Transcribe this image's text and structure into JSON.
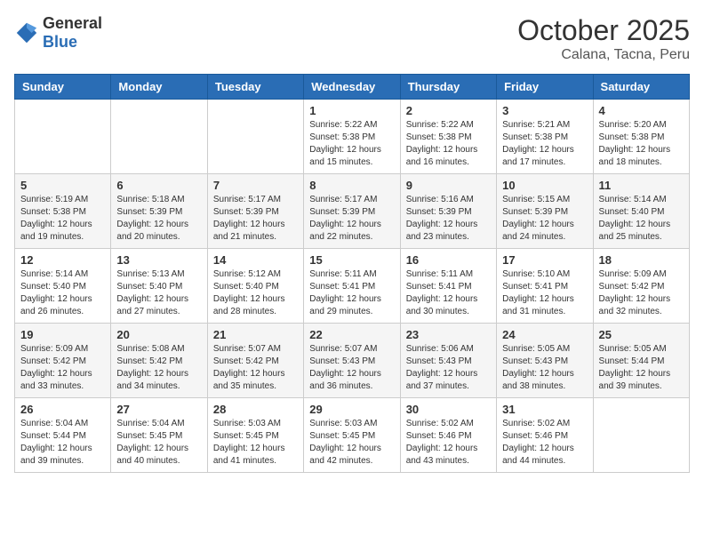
{
  "header": {
    "logo_general": "General",
    "logo_blue": "Blue",
    "month": "October 2025",
    "location": "Calana, Tacna, Peru"
  },
  "weekdays": [
    "Sunday",
    "Monday",
    "Tuesday",
    "Wednesday",
    "Thursday",
    "Friday",
    "Saturday"
  ],
  "weeks": [
    [
      {
        "day": "",
        "sunrise": "",
        "sunset": "",
        "daylight": ""
      },
      {
        "day": "",
        "sunrise": "",
        "sunset": "",
        "daylight": ""
      },
      {
        "day": "",
        "sunrise": "",
        "sunset": "",
        "daylight": ""
      },
      {
        "day": "1",
        "sunrise": "Sunrise: 5:22 AM",
        "sunset": "Sunset: 5:38 PM",
        "daylight": "Daylight: 12 hours and 15 minutes."
      },
      {
        "day": "2",
        "sunrise": "Sunrise: 5:22 AM",
        "sunset": "Sunset: 5:38 PM",
        "daylight": "Daylight: 12 hours and 16 minutes."
      },
      {
        "day": "3",
        "sunrise": "Sunrise: 5:21 AM",
        "sunset": "Sunset: 5:38 PM",
        "daylight": "Daylight: 12 hours and 17 minutes."
      },
      {
        "day": "4",
        "sunrise": "Sunrise: 5:20 AM",
        "sunset": "Sunset: 5:38 PM",
        "daylight": "Daylight: 12 hours and 18 minutes."
      }
    ],
    [
      {
        "day": "5",
        "sunrise": "Sunrise: 5:19 AM",
        "sunset": "Sunset: 5:38 PM",
        "daylight": "Daylight: 12 hours and 19 minutes."
      },
      {
        "day": "6",
        "sunrise": "Sunrise: 5:18 AM",
        "sunset": "Sunset: 5:39 PM",
        "daylight": "Daylight: 12 hours and 20 minutes."
      },
      {
        "day": "7",
        "sunrise": "Sunrise: 5:17 AM",
        "sunset": "Sunset: 5:39 PM",
        "daylight": "Daylight: 12 hours and 21 minutes."
      },
      {
        "day": "8",
        "sunrise": "Sunrise: 5:17 AM",
        "sunset": "Sunset: 5:39 PM",
        "daylight": "Daylight: 12 hours and 22 minutes."
      },
      {
        "day": "9",
        "sunrise": "Sunrise: 5:16 AM",
        "sunset": "Sunset: 5:39 PM",
        "daylight": "Daylight: 12 hours and 23 minutes."
      },
      {
        "day": "10",
        "sunrise": "Sunrise: 5:15 AM",
        "sunset": "Sunset: 5:39 PM",
        "daylight": "Daylight: 12 hours and 24 minutes."
      },
      {
        "day": "11",
        "sunrise": "Sunrise: 5:14 AM",
        "sunset": "Sunset: 5:40 PM",
        "daylight": "Daylight: 12 hours and 25 minutes."
      }
    ],
    [
      {
        "day": "12",
        "sunrise": "Sunrise: 5:14 AM",
        "sunset": "Sunset: 5:40 PM",
        "daylight": "Daylight: 12 hours and 26 minutes."
      },
      {
        "day": "13",
        "sunrise": "Sunrise: 5:13 AM",
        "sunset": "Sunset: 5:40 PM",
        "daylight": "Daylight: 12 hours and 27 minutes."
      },
      {
        "day": "14",
        "sunrise": "Sunrise: 5:12 AM",
        "sunset": "Sunset: 5:40 PM",
        "daylight": "Daylight: 12 hours and 28 minutes."
      },
      {
        "day": "15",
        "sunrise": "Sunrise: 5:11 AM",
        "sunset": "Sunset: 5:41 PM",
        "daylight": "Daylight: 12 hours and 29 minutes."
      },
      {
        "day": "16",
        "sunrise": "Sunrise: 5:11 AM",
        "sunset": "Sunset: 5:41 PM",
        "daylight": "Daylight: 12 hours and 30 minutes."
      },
      {
        "day": "17",
        "sunrise": "Sunrise: 5:10 AM",
        "sunset": "Sunset: 5:41 PM",
        "daylight": "Daylight: 12 hours and 31 minutes."
      },
      {
        "day": "18",
        "sunrise": "Sunrise: 5:09 AM",
        "sunset": "Sunset: 5:42 PM",
        "daylight": "Daylight: 12 hours and 32 minutes."
      }
    ],
    [
      {
        "day": "19",
        "sunrise": "Sunrise: 5:09 AM",
        "sunset": "Sunset: 5:42 PM",
        "daylight": "Daylight: 12 hours and 33 minutes."
      },
      {
        "day": "20",
        "sunrise": "Sunrise: 5:08 AM",
        "sunset": "Sunset: 5:42 PM",
        "daylight": "Daylight: 12 hours and 34 minutes."
      },
      {
        "day": "21",
        "sunrise": "Sunrise: 5:07 AM",
        "sunset": "Sunset: 5:42 PM",
        "daylight": "Daylight: 12 hours and 35 minutes."
      },
      {
        "day": "22",
        "sunrise": "Sunrise: 5:07 AM",
        "sunset": "Sunset: 5:43 PM",
        "daylight": "Daylight: 12 hours and 36 minutes."
      },
      {
        "day": "23",
        "sunrise": "Sunrise: 5:06 AM",
        "sunset": "Sunset: 5:43 PM",
        "daylight": "Daylight: 12 hours and 37 minutes."
      },
      {
        "day": "24",
        "sunrise": "Sunrise: 5:05 AM",
        "sunset": "Sunset: 5:43 PM",
        "daylight": "Daylight: 12 hours and 38 minutes."
      },
      {
        "day": "25",
        "sunrise": "Sunrise: 5:05 AM",
        "sunset": "Sunset: 5:44 PM",
        "daylight": "Daylight: 12 hours and 39 minutes."
      }
    ],
    [
      {
        "day": "26",
        "sunrise": "Sunrise: 5:04 AM",
        "sunset": "Sunset: 5:44 PM",
        "daylight": "Daylight: 12 hours and 39 minutes."
      },
      {
        "day": "27",
        "sunrise": "Sunrise: 5:04 AM",
        "sunset": "Sunset: 5:45 PM",
        "daylight": "Daylight: 12 hours and 40 minutes."
      },
      {
        "day": "28",
        "sunrise": "Sunrise: 5:03 AM",
        "sunset": "Sunset: 5:45 PM",
        "daylight": "Daylight: 12 hours and 41 minutes."
      },
      {
        "day": "29",
        "sunrise": "Sunrise: 5:03 AM",
        "sunset": "Sunset: 5:45 PM",
        "daylight": "Daylight: 12 hours and 42 minutes."
      },
      {
        "day": "30",
        "sunrise": "Sunrise: 5:02 AM",
        "sunset": "Sunset: 5:46 PM",
        "daylight": "Daylight: 12 hours and 43 minutes."
      },
      {
        "day": "31",
        "sunrise": "Sunrise: 5:02 AM",
        "sunset": "Sunset: 5:46 PM",
        "daylight": "Daylight: 12 hours and 44 minutes."
      },
      {
        "day": "",
        "sunrise": "",
        "sunset": "",
        "daylight": ""
      }
    ]
  ]
}
